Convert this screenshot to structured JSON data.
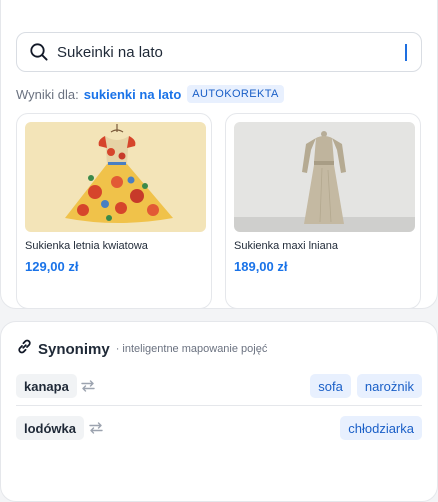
{
  "search": {
    "value": "Sukeinki na lato",
    "icon": "search-icon"
  },
  "results": {
    "label": "Wyniki dla:",
    "query": "sukienki na lato",
    "badge": "AUTOKOREKTA"
  },
  "products": [
    {
      "name": "Sukienka letnia kwiatowa",
      "price": "129,00 zł",
      "image": "floral-dress-image"
    },
    {
      "name": "Sukienka maxi lniana",
      "price": "189,00 zł",
      "image": "linen-maxi-dress-image"
    }
  ],
  "synonyms": {
    "icon": "link-icon",
    "title": "Synonimy",
    "subtitle": "· inteligentne mapowanie pojęć",
    "rows": [
      {
        "term": "kanapa",
        "synonyms": [
          "sofa",
          "narożnik"
        ]
      },
      {
        "term": "lodówka",
        "synonyms": [
          "chłodziarka"
        ]
      }
    ]
  },
  "colors": {
    "accent": "#1a73e8",
    "badge_bg": "#e8f0fe",
    "chip_text": "#1a5fc7"
  }
}
